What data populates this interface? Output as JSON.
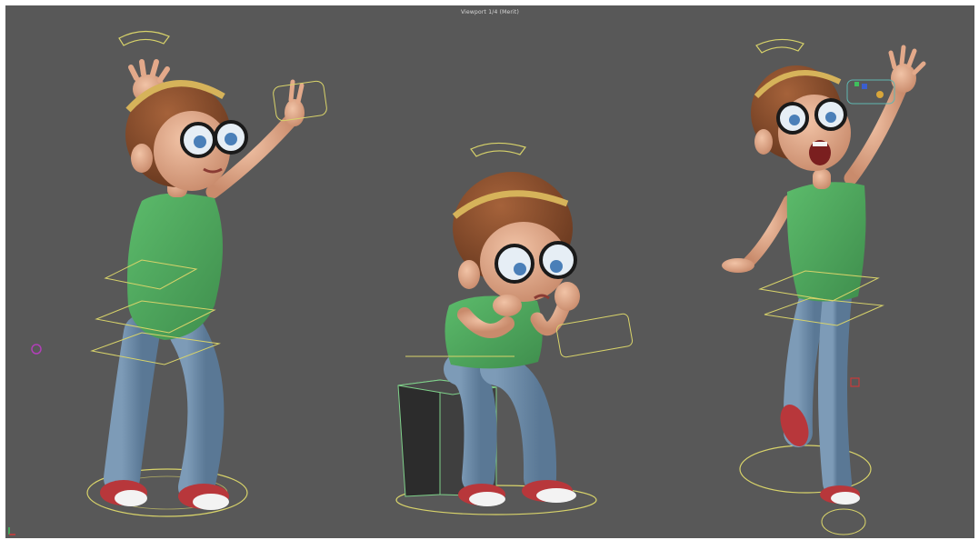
{
  "viewport": {
    "label": "Viewport 1/4 (Merit)",
    "background": "#585858"
  },
  "colors": {
    "shirt": "#4aa35a",
    "jeans": "#6b8aa8",
    "skin": "#e3a98a",
    "hair": "#8a4d2c",
    "headband": "#d6b35a",
    "rig_control": "#d8d36a",
    "shoe": "#b8373b",
    "box": "#3b3b3b",
    "box_edge": "#7fd18a"
  },
  "characters": [
    {
      "pose": "arms-raised-celebrating",
      "icon": "character-figure"
    },
    {
      "pose": "seated-sad-chin-in-hands",
      "icon": "character-figure"
    },
    {
      "pose": "excited-one-hand-waving",
      "icon": "character-figure"
    }
  ],
  "icons": {
    "axis": "axis-gizmo-icon",
    "translate": "translate-control-icon"
  }
}
